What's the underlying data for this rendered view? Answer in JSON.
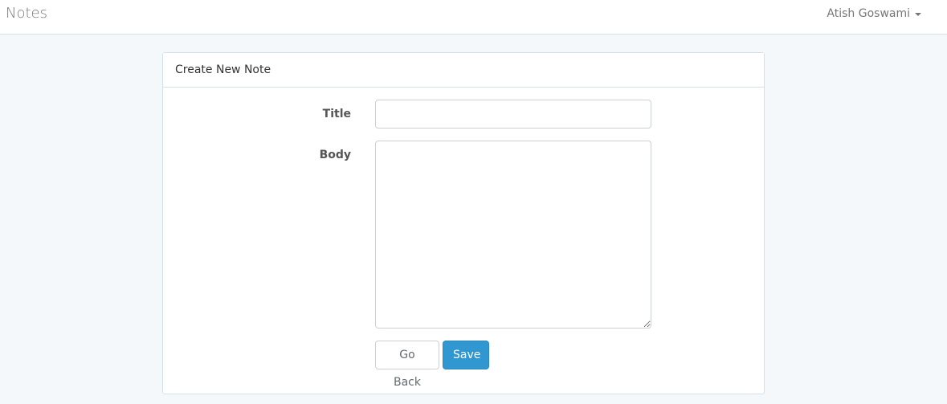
{
  "navbar": {
    "brand": "Notes",
    "user_name": "Atish Goswami",
    "user_menu_icon": "caret-down-icon"
  },
  "panel": {
    "heading": "Create New Note",
    "form": {
      "title_label": "Title",
      "title_value": "",
      "body_label": "Body",
      "body_value": "",
      "go_back_label": "Go Back",
      "save_label": "Save"
    }
  },
  "colors": {
    "background": "#f5f8fa",
    "primary": "#3097d1",
    "border": "#d3e0e9"
  }
}
